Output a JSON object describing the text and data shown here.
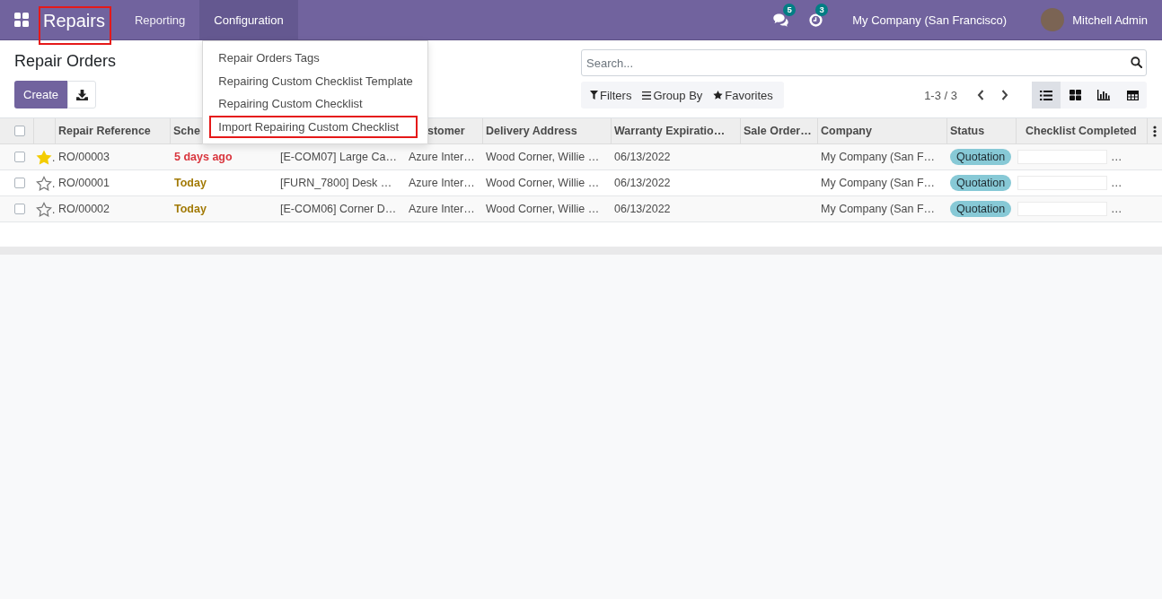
{
  "navbar": {
    "app_name": "Repairs",
    "app_name_highlighted": true,
    "menus": [
      {
        "label": "Reporting",
        "selected": false
      },
      {
        "label": "Configuration",
        "selected": true
      }
    ],
    "message_count": "5",
    "activity_count": "3",
    "company": "My Company (San Francisco)",
    "user": "Mitchell Admin"
  },
  "configuration_menu": [
    {
      "label": "Repair Orders Tags",
      "highlighted": false
    },
    {
      "label": "Repairing Custom Checklist Template",
      "highlighted": false
    },
    {
      "label": "Repairing Custom Checklist",
      "highlighted": false
    },
    {
      "label": "Import Repairing Custom Checklist",
      "highlighted": true
    }
  ],
  "control_panel": {
    "title": "Repair Orders",
    "create_button": "Create",
    "search": {
      "placeholder": "Search..."
    },
    "search_options": [
      {
        "label": "Filters",
        "kind": "filter"
      },
      {
        "label": "Group By",
        "kind": "group"
      },
      {
        "label": "Favorites",
        "kind": "favorites"
      }
    ],
    "pager": "1-3 / 3",
    "views": [
      {
        "kind": "list",
        "selected": true
      },
      {
        "kind": "kanban",
        "selected": false
      },
      {
        "kind": "graph",
        "selected": false
      },
      {
        "kind": "pivot",
        "selected": false
      }
    ]
  },
  "table": {
    "all_checked": false,
    "columns": [
      "Repair Reference",
      "Sche",
      "stomer",
      "Delivery Address",
      "Warranty Expiratio…",
      "Sale Order…",
      "Company",
      "Status",
      "Checklist Completed"
    ],
    "rows": [
      {
        "selected": false,
        "starred": true,
        "priority_overflow": ".",
        "reference": "RO/00003",
        "column_2": {
          "text": "5 days ago",
          "color": "#d9363e"
        },
        "column_3": "[E-COM07] Large Ca…",
        "column_4": "Azure Inter…",
        "delivery_address": "Wood Corner, Willie …",
        "warranty_expiration": "06/13/2022",
        "company": "My Company (San F…",
        "status": "Quotation",
        "checklist_completed": {
          "level": 0,
          "text": "…"
        }
      },
      {
        "selected": false,
        "starred": false,
        "priority_overflow": ".",
        "reference": "RO/00001",
        "column_2": {
          "text": "Today",
          "color": "#a27a06"
        },
        "column_3": "[FURN_7800] Desk …",
        "column_4": "Azure Inter…",
        "delivery_address": "Wood Corner, Willie …",
        "warranty_expiration": "06/13/2022",
        "company": "My Company (San F…",
        "status": "Quotation",
        "checklist_completed": {
          "level": 0,
          "text": "…"
        }
      },
      {
        "selected": false,
        "starred": false,
        "priority_overflow": ".",
        "reference": "RO/00002",
        "column_2": {
          "text": "Today",
          "color": "#a27a06"
        },
        "column_3": "[E-COM06] Corner D…",
        "column_4": "Azure Inter…",
        "delivery_address": "Wood Corner, Willie …",
        "warranty_expiration": "06/13/2022",
        "company": "My Company (San F…",
        "status": "Quotation",
        "checklist_completed": {
          "level": 0,
          "text": "…"
        }
      }
    ]
  }
}
